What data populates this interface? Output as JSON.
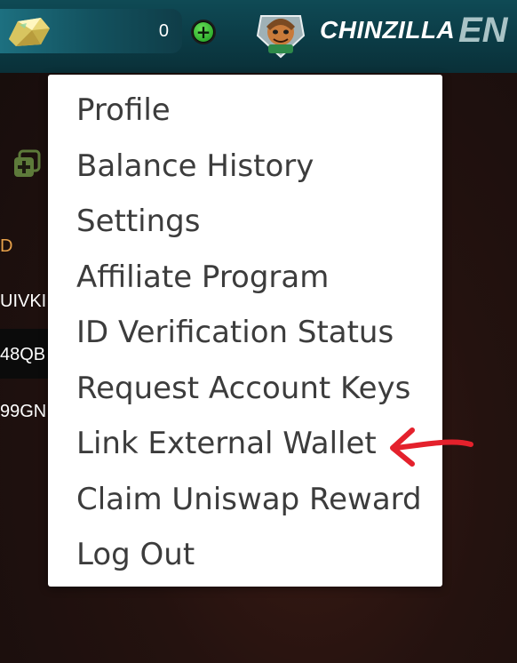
{
  "header": {
    "balance": "0",
    "username": "CHINZILLA",
    "language": "EN",
    "icons": {
      "balance": "crystal-gem-icon",
      "add_funds": "plus-circle-icon",
      "avatar": "character-avatar"
    },
    "colors": {
      "bar": "#0b3a44",
      "accent_green": "#2fae2d"
    }
  },
  "background": {
    "icon": "add-square-icon",
    "rows": [
      "D",
      "UIVKI",
      "48QB",
      "99GN"
    ]
  },
  "account_menu": {
    "items": [
      "Profile",
      "Balance History",
      "Settings",
      "Affiliate Program",
      "ID Verification Status",
      "Request Account Keys",
      "Link External Wallet",
      "Claim Uniswap Reward",
      "Log Out"
    ]
  },
  "annotation": {
    "type": "red-arrow",
    "points_to": "Link External Wallet",
    "color": "#e4212c"
  }
}
